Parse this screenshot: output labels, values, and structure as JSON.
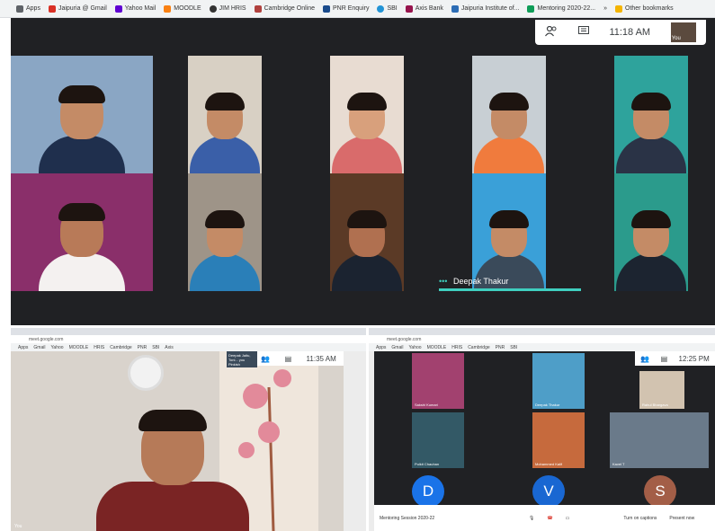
{
  "bookmarks": [
    "Apps",
    "Jaipuria @ Gmail",
    "Yahoo Mail",
    "MOODLE",
    "JIM HRIS",
    "Cambridge Online",
    "PNR Enquiry",
    "SBI",
    "Axis Bank",
    "Jaipuria Institute of...",
    "Mentoring 2020-22...",
    "Other bookmarks"
  ],
  "bookmark_more": "»",
  "meet_top": {
    "time": "11:18 AM",
    "participants_icon": "people-icon",
    "chat_icon": "chat-icon",
    "participant_label": "You",
    "speaker_dots": "•••",
    "speaker_name": "Deepak Thakur"
  },
  "lower_left": {
    "time": "11:35 AM",
    "you_label": "You",
    "overlay_text": "Deepak Jaitu, Toni... you Pinkish"
  },
  "lower_right": {
    "time": "12:25 PM",
    "names": [
      "Sakshi Kumari",
      "Deepak Thakur",
      "Rahul Bhargava",
      "Pulkit Chauhan",
      "Mohammed Kalif",
      "Kavel T"
    ],
    "avatars": [
      "D",
      "V",
      "S"
    ],
    "meeting_title": "Mentoring Session 2020-22",
    "turn_on_captions": "Turn on captions",
    "present_now": "Present now"
  },
  "colors": {
    "meet_bg": "#202124",
    "speaking": "#3fcfbf",
    "avatar_d": "#1a73e8",
    "avatar_v": "#1967d2",
    "avatar_s": "#a35e47"
  }
}
